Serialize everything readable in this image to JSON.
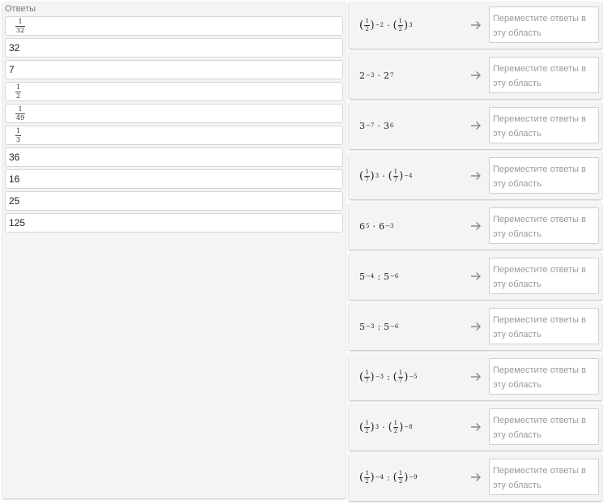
{
  "answers": {
    "title": "Ответы",
    "items": [
      {
        "type": "frac",
        "num": "1",
        "den": "32"
      },
      {
        "type": "text",
        "text": "32"
      },
      {
        "type": "text",
        "text": "7"
      },
      {
        "type": "frac",
        "num": "1",
        "den": "2"
      },
      {
        "type": "frac",
        "num": "1",
        "den": "49"
      },
      {
        "type": "frac",
        "num": "1",
        "den": "3"
      },
      {
        "type": "text",
        "text": "36"
      },
      {
        "type": "text",
        "text": "16"
      },
      {
        "type": "text",
        "text": "25"
      },
      {
        "type": "text",
        "text": "125"
      }
    ]
  },
  "drop_placeholder": "Переместите ответы в эту область",
  "arrow_icon": "arrow-right-icon",
  "questions": [
    {
      "terms": [
        {
          "frac": [
            "1",
            "2"
          ],
          "exp": "−2"
        },
        {
          "op": "·"
        },
        {
          "frac": [
            "1",
            "2"
          ],
          "exp": "3"
        }
      ]
    },
    {
      "terms": [
        {
          "base": "2",
          "exp": "−3"
        },
        {
          "op": "·"
        },
        {
          "base": "2",
          "exp": "7"
        }
      ]
    },
    {
      "terms": [
        {
          "base": "3",
          "exp": "−7"
        },
        {
          "op": "·"
        },
        {
          "base": "3",
          "exp": "6"
        }
      ]
    },
    {
      "terms": [
        {
          "frac": [
            "1",
            "7"
          ],
          "exp": "3"
        },
        {
          "op": "·"
        },
        {
          "frac": [
            "1",
            "7"
          ],
          "exp": "−4"
        }
      ]
    },
    {
      "terms": [
        {
          "base": "6",
          "exp": "5"
        },
        {
          "op": "·"
        },
        {
          "base": "6",
          "exp": "−3"
        }
      ]
    },
    {
      "terms": [
        {
          "base": "5",
          "exp": "−4"
        },
        {
          "op": ":"
        },
        {
          "base": "5",
          "exp": "−6"
        }
      ]
    },
    {
      "terms": [
        {
          "base": "5",
          "exp": "−3"
        },
        {
          "op": ":"
        },
        {
          "base": "5",
          "exp": "−6"
        }
      ]
    },
    {
      "terms": [
        {
          "frac": [
            "1",
            "7"
          ],
          "exp": "−3"
        },
        {
          "op": ":"
        },
        {
          "frac": [
            "1",
            "7"
          ],
          "exp": "−5"
        }
      ]
    },
    {
      "terms": [
        {
          "frac": [
            "1",
            "2"
          ],
          "exp": "3"
        },
        {
          "op": "·"
        },
        {
          "frac": [
            "1",
            "2"
          ],
          "exp": "−8"
        }
      ]
    },
    {
      "terms": [
        {
          "frac": [
            "1",
            "2"
          ],
          "exp": "−4"
        },
        {
          "op": ":"
        },
        {
          "frac": [
            "1",
            "2"
          ],
          "exp": "−9"
        }
      ]
    }
  ]
}
